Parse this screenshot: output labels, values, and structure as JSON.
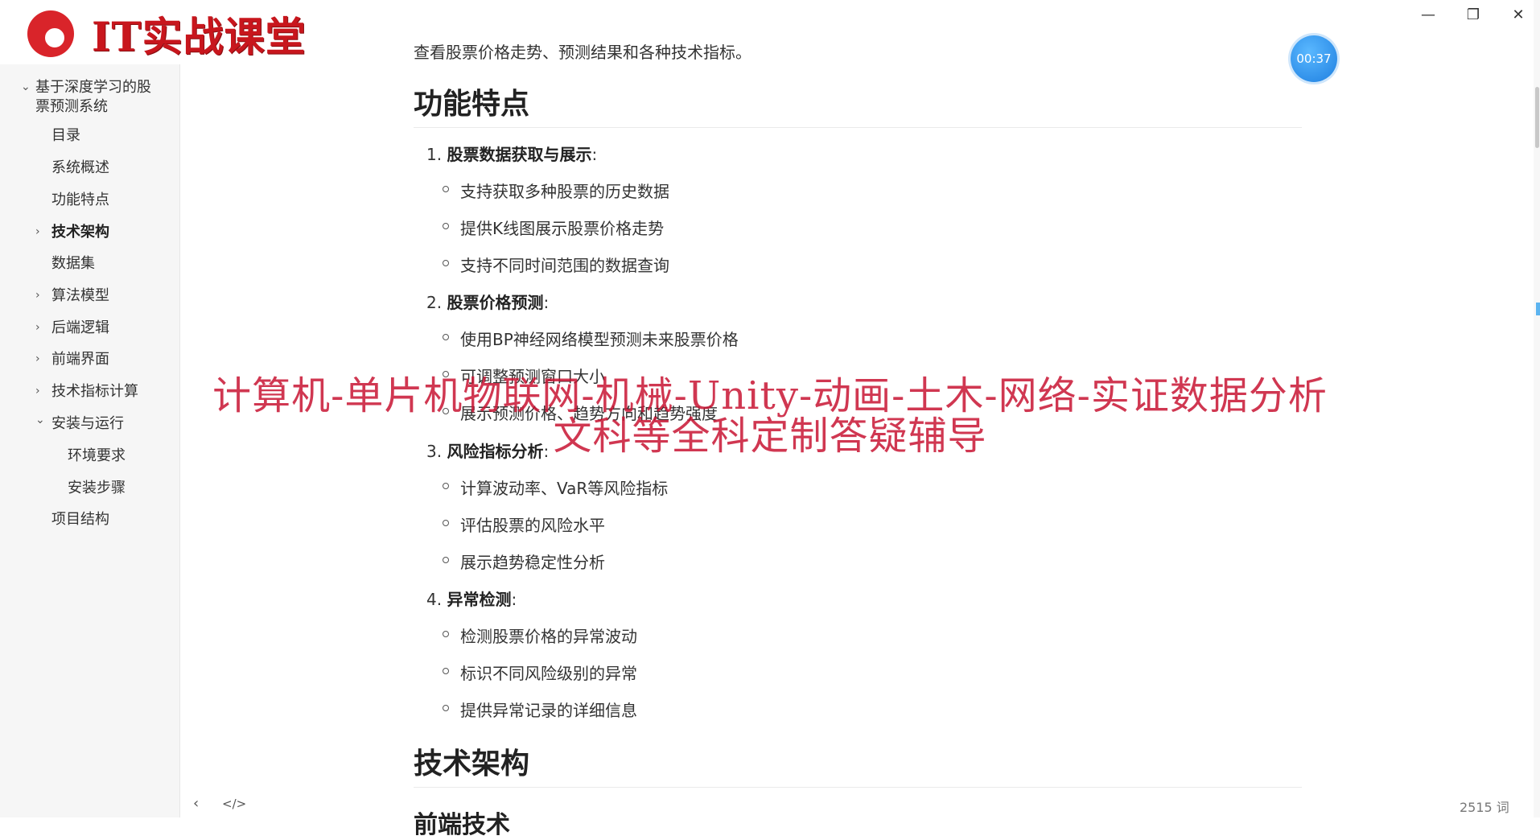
{
  "logo": {
    "text": "IT实战课堂"
  },
  "timer": "00:37",
  "sidebar": {
    "root": "基于深度学习的股票预测系统",
    "items": [
      {
        "label": "目录"
      },
      {
        "label": "系统概述"
      },
      {
        "label": "功能特点"
      },
      {
        "label": "技术架构"
      },
      {
        "label": "数据集"
      },
      {
        "label": "算法模型"
      },
      {
        "label": "后端逻辑"
      },
      {
        "label": "前端界面"
      },
      {
        "label": "技术指标计算"
      },
      {
        "label": "安装与运行"
      },
      {
        "label": "环境要求"
      },
      {
        "label": "安装步骤"
      },
      {
        "label": "项目结构"
      }
    ]
  },
  "content": {
    "intro": "查看股票价格走势、预测结果和各种技术指标。",
    "features_heading": "功能特点",
    "features": [
      {
        "num": "1.",
        "title": "股票数据获取与展示",
        "items": [
          "支持获取多种股票的历史数据",
          "提供K线图展示股票价格走势",
          "支持不同时间范围的数据查询"
        ]
      },
      {
        "num": "2.",
        "title": "股票价格预测",
        "items": [
          "使用BP神经网络模型预测未来股票价格",
          "可调整预测窗口大小",
          "展示预测价格、趋势方向和趋势强度"
        ]
      },
      {
        "num": "3.",
        "title": "风险指标分析",
        "items": [
          "计算波动率、VaR等风险指标",
          "评估股票的风险水平",
          "展示趋势稳定性分析"
        ]
      },
      {
        "num": "4.",
        "title": "异常检测",
        "items": [
          "检测股票价格的异常波动",
          "标识不同风险级别的异常",
          "提供异常记录的详细信息"
        ]
      }
    ],
    "arch_heading": "技术架构",
    "sub_heading": "前端技术"
  },
  "overlay": {
    "line1": "计算机-单片机物联网-机械-Unity-动画-土木-网络-实证数据分析",
    "line2": "文科等全科定制答疑辅导"
  },
  "footer": {
    "word_count": "2515 词"
  }
}
